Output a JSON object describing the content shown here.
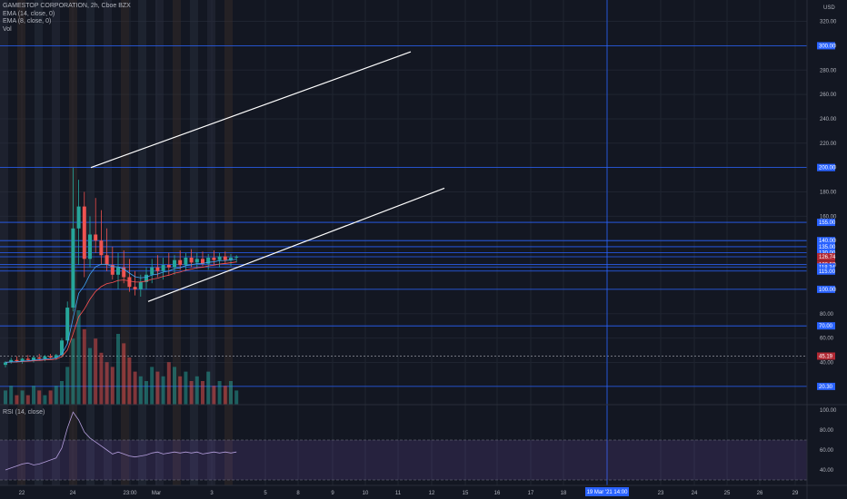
{
  "legend": {
    "title": "GAMESTOP CORPORATION, 2h, Cboe BZX",
    "ema14": "EMA (14, close, 0)",
    "ema8": "EMA (8, close, 0)",
    "vol": "Vol"
  },
  "rsi": {
    "label": "RSI (14, close)"
  },
  "chart_data": {
    "type": "candlestick",
    "currency": "USD",
    "price_ticks": [
      "320.00",
      "300.00",
      "280.00",
      "260.00",
      "240.00",
      "220.00",
      "200.00",
      "180.00",
      "160.00",
      "140.00",
      "120.00",
      "100.00",
      "80.00",
      "60.00",
      "40.00"
    ],
    "rsi_ticks": [
      "100.00",
      "80.00",
      "60.00",
      "40.00"
    ],
    "x_ticks": [
      "22",
      "24",
      "23:00",
      "Mar",
      "3",
      "5",
      "8",
      "9",
      "10",
      "11",
      "12",
      "15",
      "16",
      "17",
      "18",
      "19 Mar '21  14:00",
      "23",
      "24",
      "25",
      "26",
      "29"
    ],
    "horizontal_levels": [
      "300.00",
      "200.00",
      "155.00",
      "140.00",
      "135.00",
      "130.00",
      "126.74",
      "120.53",
      "118.34",
      "115.00",
      "100.00",
      "70.00",
      "45.19",
      "20.30"
    ],
    "crosshair": {
      "time": "19 Mar '21  14:00"
    },
    "last_price": "45.19",
    "trendlines": [
      {
        "from": [
          "24",
          200
        ],
        "to": [
          "11",
          295
        ]
      },
      {
        "from": [
          "23:00",
          90
        ],
        "to": [
          "12",
          183
        ]
      }
    ],
    "candles": [
      [
        38,
        41,
        36,
        40
      ],
      [
        40,
        44,
        39,
        42
      ],
      [
        42,
        45,
        40,
        41
      ],
      [
        41,
        44,
        39,
        43
      ],
      [
        43,
        46,
        41,
        42
      ],
      [
        42,
        45,
        40,
        44
      ],
      [
        44,
        47,
        42,
        43
      ],
      [
        43,
        46,
        41,
        45
      ],
      [
        45,
        47,
        43,
        44
      ],
      [
        44,
        47,
        42,
        46
      ],
      [
        46,
        60,
        44,
        58
      ],
      [
        58,
        90,
        55,
        85
      ],
      [
        85,
        200,
        82,
        150
      ],
      [
        150,
        190,
        120,
        168
      ],
      [
        168,
        180,
        110,
        125
      ],
      [
        125,
        160,
        118,
        145
      ],
      [
        145,
        175,
        130,
        140
      ],
      [
        140,
        165,
        120,
        128
      ],
      [
        128,
        150,
        115,
        120
      ],
      [
        120,
        135,
        108,
        112
      ],
      [
        112,
        130,
        100,
        118
      ],
      [
        118,
        132,
        105,
        110
      ],
      [
        110,
        125,
        98,
        102
      ],
      [
        102,
        115,
        95,
        100
      ],
      [
        100,
        112,
        94,
        106
      ],
      [
        106,
        118,
        100,
        112
      ],
      [
        112,
        125,
        105,
        118
      ],
      [
        118,
        128,
        110,
        115
      ],
      [
        115,
        126,
        108,
        120
      ],
      [
        120,
        130,
        112,
        118
      ],
      [
        118,
        128,
        112,
        124
      ],
      [
        124,
        132,
        116,
        120
      ],
      [
        120,
        130,
        115,
        126
      ],
      [
        126,
        133,
        118,
        122
      ],
      [
        122,
        130,
        117,
        125
      ],
      [
        125,
        131,
        119,
        121
      ],
      [
        121,
        129,
        116,
        126
      ],
      [
        126,
        132,
        120,
        124
      ],
      [
        124,
        130,
        118,
        127
      ],
      [
        127,
        131,
        121,
        124
      ],
      [
        124,
        129,
        119,
        126
      ],
      [
        126,
        128,
        122,
        126.74
      ]
    ],
    "volumes": [
      3,
      4,
      2,
      3,
      2,
      4,
      3,
      2,
      3,
      4,
      5,
      8,
      14,
      20,
      16,
      12,
      14,
      11,
      9,
      8,
      15,
      13,
      10,
      7,
      6,
      5,
      8,
      7,
      6,
      9,
      8,
      6,
      7,
      5,
      6,
      5,
      7,
      4,
      5,
      4,
      5,
      3
    ],
    "rsi_values": [
      40,
      42,
      44,
      46,
      47,
      45,
      46,
      48,
      50,
      52,
      62,
      82,
      98,
      90,
      78,
      72,
      68,
      64,
      60,
      56,
      58,
      56,
      54,
      53,
      54,
      55,
      57,
      58,
      56,
      57,
      58,
      57,
      58,
      57,
      58,
      56,
      57,
      58,
      57,
      58,
      57,
      58
    ]
  }
}
